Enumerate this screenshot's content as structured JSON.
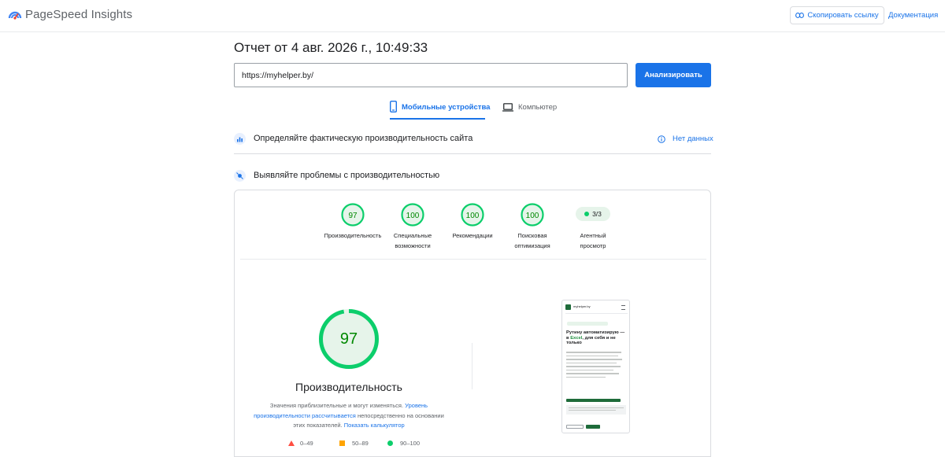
{
  "app": {
    "title": "PageSpeed Insights"
  },
  "header": {
    "copy_link_label": "Скопировать ссылку",
    "docs_label": "Документация"
  },
  "report": {
    "title": "Отчет от 4 авг. 2026 г., 10:49:33",
    "url_value": "https://myhelper.by/",
    "analyze_label": "Анализировать"
  },
  "tabs": {
    "mobile": "Мобильные устройства",
    "desktop": "Компьютер",
    "active": "mobile"
  },
  "field_section": {
    "title": "Определяйте фактическую производительность сайта",
    "no_data_label": "Нет данных"
  },
  "lab_section": {
    "title": "Выявляйте проблемы с производительностью"
  },
  "scores": [
    {
      "value": "97",
      "label_line1": "Производительность",
      "label_line2": ""
    },
    {
      "value": "100",
      "label_line1": "Специальные",
      "label_line2": "возможности"
    },
    {
      "value": "100",
      "label_line1": "Рекомендации",
      "label_line2": ""
    },
    {
      "value": "100",
      "label_line1": "Поисковая",
      "label_line2": "оптимизация"
    }
  ],
  "agent": {
    "value": "3/3",
    "label_line1": "Агентный",
    "label_line2": "просмотр"
  },
  "performance": {
    "score": "97",
    "score_fraction": 0.97,
    "title": "Производительность",
    "note_text1": "Значения приблизительные и могут изменяться.",
    "note_link1": "Уровень производительности рассчитывается",
    "note_text2": "непосредственно на основании этих показателей.",
    "note_link2": "Показать калькулятор"
  },
  "legend": {
    "poor": "0–49",
    "average": "50–89",
    "good": "90–100"
  },
  "thumbnail": {
    "site_name": "myhelper.by",
    "headline_part1": "Рутину автоматизирую — в ",
    "headline_accent": "Excel",
    "headline_part2": ", для себя и не только"
  },
  "colors": {
    "accent": "#1a73e8",
    "good": "#0cce6b",
    "good_text": "#008800",
    "good_bg": "#e6f4ea",
    "average": "#ffa400",
    "poor": "#ff4e42"
  }
}
